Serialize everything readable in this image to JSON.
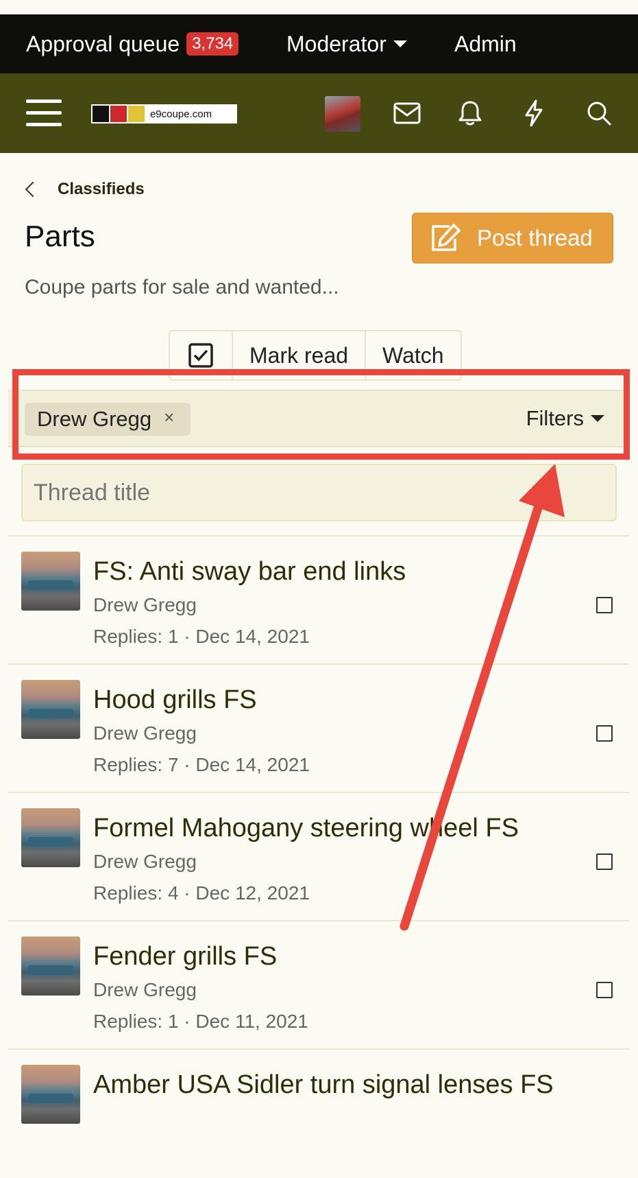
{
  "staff_bar": {
    "approval_label": "Approval queue",
    "approval_count": "3,734",
    "moderator_label": "Moderator",
    "admin_label": "Admin"
  },
  "nav": {
    "site_name": "e9coupe.com",
    "icons": [
      "menu-icon",
      "envelope-icon",
      "bell-icon",
      "lightning-icon",
      "search-icon"
    ],
    "colors": {
      "bar": "#454911",
      "staff": "#0e0e0b"
    }
  },
  "breadcrumb": {
    "label": "Classifieds"
  },
  "forum": {
    "title": "Parts",
    "description": "Coupe parts for sale and wanted...",
    "post_thread_label": "Post thread",
    "post_thread_color": "#e79e3d"
  },
  "actions": {
    "mark_read": "Mark read",
    "watch": "Watch"
  },
  "filter_bar": {
    "active_filter": "Drew Gregg",
    "remove_glyph": "×",
    "filters_label": "Filters"
  },
  "search": {
    "placeholder": "Thread title"
  },
  "threads": [
    {
      "title": "FS: Anti sway bar end links",
      "author": "Drew Gregg",
      "meta": "Replies: 1 · Dec 14, 2021"
    },
    {
      "title": "Hood grills FS",
      "author": "Drew Gregg",
      "meta": "Replies: 7 · Dec 14, 2021"
    },
    {
      "title": "Formel Mahogany steering wheel FS",
      "author": "Drew Gregg",
      "meta": "Replies: 4 · Dec 12, 2021"
    },
    {
      "title": "Fender grills FS",
      "author": "Drew Gregg",
      "meta": "Replies: 1 · Dec 11, 2021"
    },
    {
      "title": "Amber USA Sidler turn signal lenses FS",
      "author": "",
      "meta": ""
    }
  ],
  "annotation": {
    "color": "#e9473d"
  }
}
